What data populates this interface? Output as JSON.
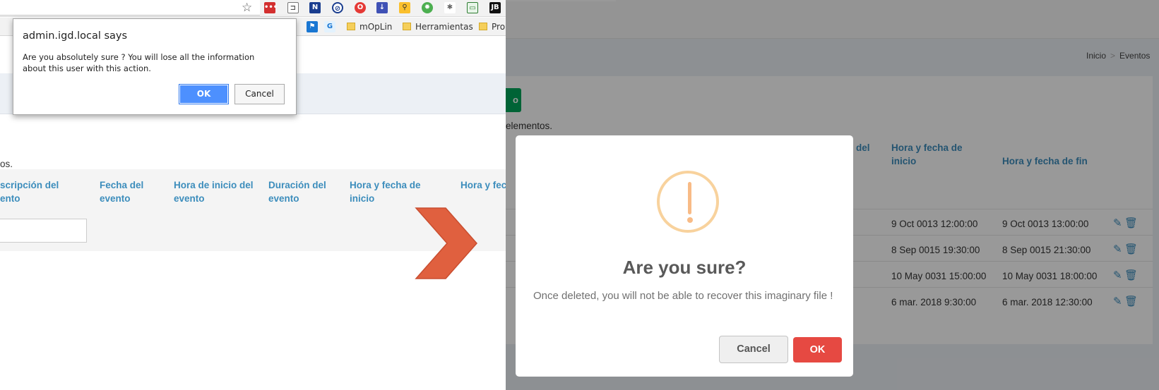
{
  "left": {
    "bookmarks": [
      "mOpLin",
      "Herramientas",
      "Pro"
    ],
    "records_text": "os.",
    "table_headers": [
      {
        "line1": "scripción del",
        "line2": "ento"
      },
      {
        "line1": "Fecha del",
        "line2": "evento"
      },
      {
        "line1": "Hora de inicio del",
        "line2": "evento"
      },
      {
        "line1": "Duración del",
        "line2": "evento"
      },
      {
        "line1": "Hora y fecha de",
        "line2": "inicio"
      },
      {
        "line1": "",
        "line2": "Hora y fec"
      }
    ],
    "alert": {
      "title": "admin.igd.local says",
      "message": "Are you absolutely sure ? You will lose all the information about this user with this action.",
      "ok_label": "OK",
      "cancel_label": "Cancel"
    },
    "icons": [
      "star-icon",
      "extension-icon"
    ]
  },
  "right": {
    "breadcrumb": {
      "home": "Inicio",
      "separator": ">",
      "current": "Eventos"
    },
    "new_button_label": "o",
    "records_text": "elementos.",
    "table_headers": {
      "partial": "del",
      "start": {
        "line1": "Hora y fecha de",
        "line2": "inicio"
      },
      "end": "Hora y fecha de fin"
    },
    "rows": [
      {
        "start": "9 Oct 0013 12:00:00",
        "end": "9 Oct 0013 13:00:00"
      },
      {
        "start": "8 Sep 0015 19:30:00",
        "end": "8 Sep 0015 21:30:00"
      },
      {
        "start": "10 May 0031 15:00:00",
        "end": "10 May 0031 18:00:00"
      },
      {
        "start": "6 mar. 2018 9:30:00",
        "end": "6 mar. 2018 12:30:00"
      }
    ],
    "modal": {
      "title": "Are you sure?",
      "text": "Once deleted, you will not be able to recover this imaginary file !",
      "cancel_label": "Cancel",
      "ok_label": "OK"
    },
    "colors": {
      "confirm": "#e64942",
      "warning": "#f8bb86",
      "link": "#3c8dbc"
    }
  }
}
